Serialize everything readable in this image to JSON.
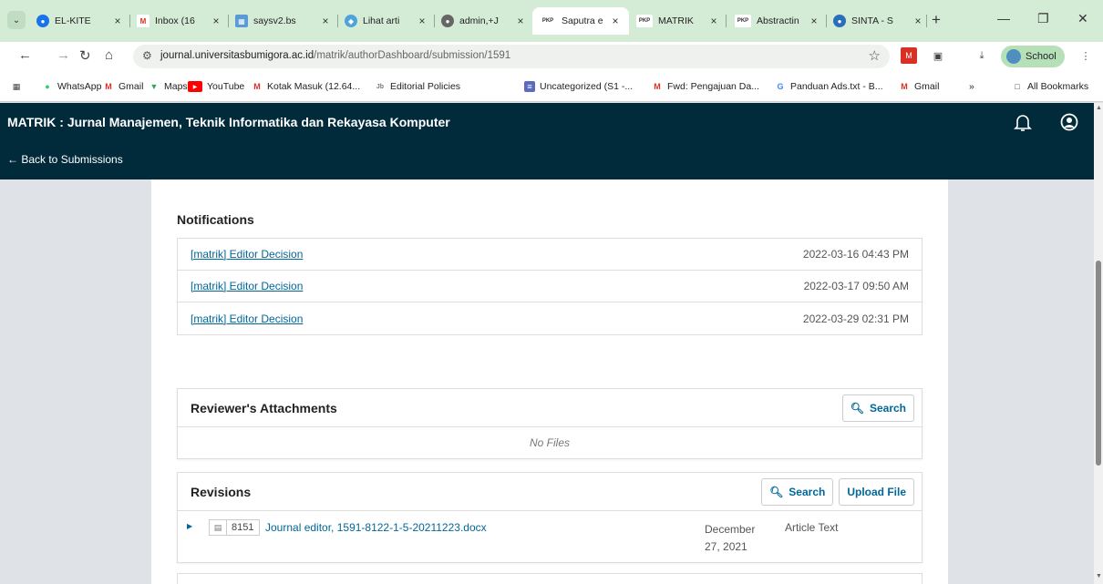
{
  "browser": {
    "tabs": [
      {
        "title": "EL-KITE",
        "icon": "globe-icon",
        "color": "#1a73e8"
      },
      {
        "title": "Inbox (16",
        "icon": "gmail-icon",
        "color": "#d93025"
      },
      {
        "title": "saysv2.bs",
        "icon": "app-icon",
        "color": "#5b9bd5"
      },
      {
        "title": "Lihat arti",
        "icon": "diamond-icon",
        "color": "#4fa3d9"
      },
      {
        "title": "admin,+J",
        "icon": "globe-icon",
        "color": "#555555"
      },
      {
        "title": "Saputra e",
        "icon": "pkp-icon",
        "color": "#333333",
        "active": true
      },
      {
        "title": "MATRIK",
        "icon": "pkp-icon",
        "color": "#333333"
      },
      {
        "title": "Abstractin",
        "icon": "pkp-icon",
        "color": "#333333"
      },
      {
        "title": "SINTA - S",
        "icon": "sinta-icon",
        "color": "#2a6ebb"
      }
    ],
    "url_domain": "journal.universitasbumigora.ac.id",
    "url_path": "/matrik/authorDashboard/submission/1591",
    "profile_label": "School",
    "bookmarks": [
      {
        "label": "WhatsApp",
        "icon": "whatsapp-icon",
        "color": "#25d366"
      },
      {
        "label": "Gmail",
        "icon": "gmail-icon",
        "color": "#d93025"
      },
      {
        "label": "Maps",
        "icon": "maps-icon",
        "color": "#34a853"
      },
      {
        "label": "YouTube",
        "icon": "youtube-icon",
        "color": "#ff0000"
      },
      {
        "label": "Kotak Masuk (12.64...",
        "icon": "gmail-icon",
        "color": "#d93025"
      },
      {
        "label": "Editorial Policies",
        "icon": "journal-icon",
        "color": "#777777"
      },
      {
        "label": "Uncategorized (S1 -...",
        "icon": "list-icon",
        "color": "#5c6bc0"
      },
      {
        "label": "Fwd: Pengajuan Da...",
        "icon": "gmail-icon",
        "color": "#d93025"
      },
      {
        "label": "Panduan Ads.txt - B...",
        "icon": "google-icon",
        "color": "#4285f4"
      },
      {
        "label": "Gmail",
        "icon": "gmail-icon",
        "color": "#d93025"
      }
    ],
    "all_bookmarks_label": "All Bookmarks"
  },
  "header": {
    "journal_title": "MATRIK : Jurnal Manajemen, Teknik Informatika dan Rekayasa Komputer",
    "back_link": "← Back to Submissions"
  },
  "notifications": {
    "title": "Notifications",
    "items": [
      {
        "label": "[matrik] Editor Decision",
        "date": "2022-03-16 04:43 PM"
      },
      {
        "label": "[matrik] Editor Decision",
        "date": "2022-03-17 09:50 AM"
      },
      {
        "label": "[matrik] Editor Decision",
        "date": "2022-03-29 02:31 PM"
      }
    ]
  },
  "reviewer_attachments": {
    "title": "Reviewer's Attachments",
    "search_label": "Search",
    "empty_label": "No Files"
  },
  "revisions": {
    "title": "Revisions",
    "search_label": "Search",
    "upload_label": "Upload File",
    "files": [
      {
        "id": "8151",
        "name": "Journal editor, 1591-8122-1-5-20211223.docx",
        "date": "December 27, 2021",
        "type": "Article Text"
      }
    ]
  }
}
